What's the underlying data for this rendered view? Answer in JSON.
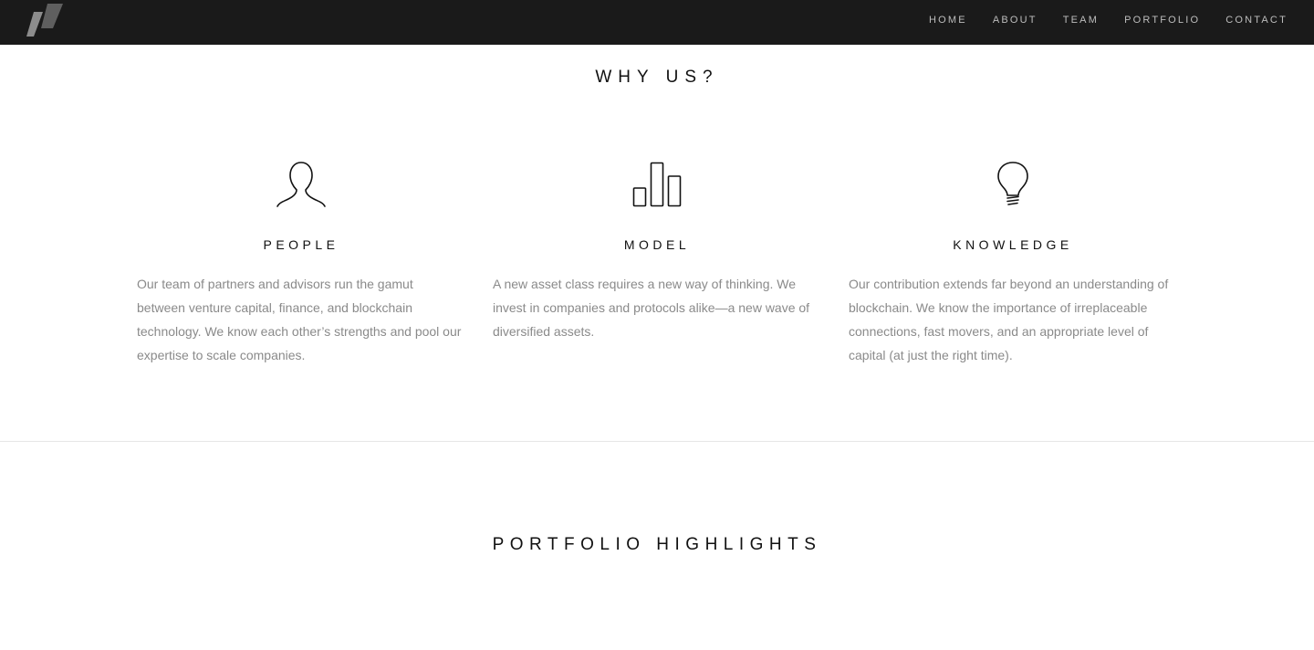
{
  "nav": {
    "links": [
      "HOME",
      "ABOUT",
      "TEAM",
      "PORTFOLIO",
      "CONTACT"
    ]
  },
  "why_us": {
    "title": "WHY US?",
    "columns": [
      {
        "icon": "person-icon",
        "heading": "PEOPLE",
        "text": "Our team of partners and advisors run the gamut between venture capital, finance, and blockchain technology. We know each other’s strengths and pool our expertise to scale companies."
      },
      {
        "icon": "bar-chart-icon",
        "heading": "MODEL",
        "text": "A new asset class requires a new way of thinking. We invest in companies and protocols alike—a new wave of diversified assets."
      },
      {
        "icon": "lightbulb-icon",
        "heading": "KNOWLEDGE",
        "text": "Our contribution extends far beyond an understanding of blockchain. We know the importance of irreplaceable connections, fast movers, and an appropriate level of capital (at just the right time)."
      }
    ]
  },
  "portfolio": {
    "title": "PORTFOLIO HIGHLIGHTS"
  },
  "colors": {
    "navbar_bg": "#1a1a1a",
    "nav_text": "#bdbdbd",
    "heading_text": "#111111",
    "body_text": "#8a8a8a"
  }
}
